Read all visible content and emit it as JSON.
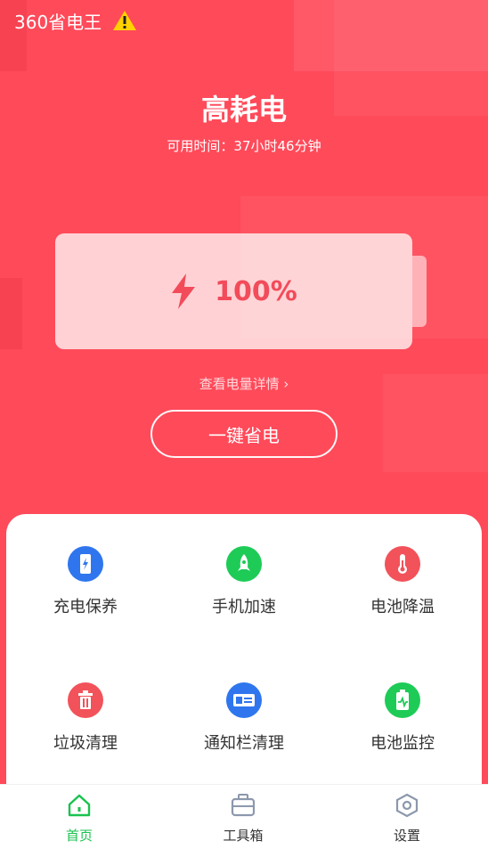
{
  "status": {
    "app_name": "360省电王"
  },
  "header": {
    "title": "高耗电",
    "subtitle": "可用时间：37小时46分钟"
  },
  "battery": {
    "level_percent": 100,
    "label": "100%"
  },
  "detail_link": "查看电量详情 ›",
  "save_button": "一键省电",
  "tools": [
    {
      "label": "充电保养",
      "icon": "phone-charge-icon",
      "color": "#2f76ee"
    },
    {
      "label": "手机加速",
      "icon": "rocket-icon",
      "color": "#1ecb57"
    },
    {
      "label": "电池降温",
      "icon": "thermometer-icon",
      "color": "#f2525a"
    },
    {
      "label": "垃圾清理",
      "icon": "trash-icon",
      "color": "#f2525a"
    },
    {
      "label": "通知栏清理",
      "icon": "id-card-icon",
      "color": "#2f76ee"
    },
    {
      "label": "电池监控",
      "icon": "battery-monitor-icon",
      "color": "#1ecb57"
    }
  ],
  "nav": [
    {
      "label": "首页",
      "icon": "home-icon",
      "active": true
    },
    {
      "label": "工具箱",
      "icon": "toolbox-icon",
      "active": false
    },
    {
      "label": "设置",
      "icon": "settings-hexagon-icon",
      "active": false
    }
  ],
  "colors": {
    "accent": "#ff4a5a",
    "active_nav": "#19c24f",
    "inactive_nav": "#8c98ac"
  }
}
